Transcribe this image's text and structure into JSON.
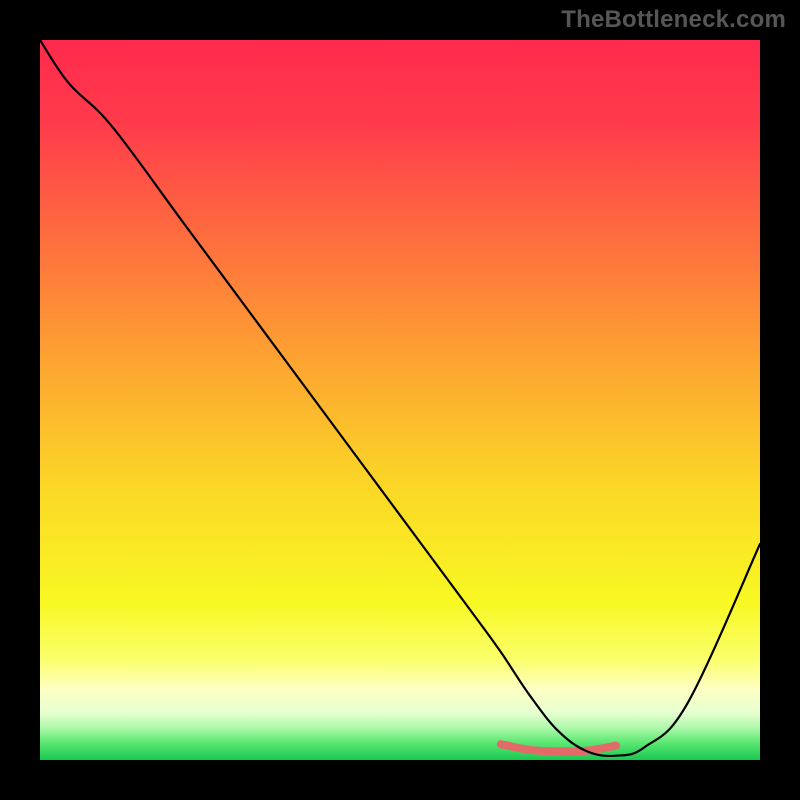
{
  "watermark": "TheBottleneck.com",
  "chart_data": {
    "type": "line",
    "title": "",
    "xlabel": "",
    "ylabel": "",
    "xlim": [
      0,
      100
    ],
    "ylim": [
      0,
      100
    ],
    "grid": false,
    "series": [
      {
        "name": "curve",
        "x": [
          0,
          4,
          10,
          20,
          30,
          40,
          50,
          60,
          64,
          68,
          72,
          76,
          80,
          84,
          90,
          100
        ],
        "y": [
          100,
          94,
          88,
          74.5,
          61,
          47.5,
          34,
          20.5,
          15,
          9,
          4,
          1.2,
          0.6,
          1.8,
          8,
          30
        ],
        "color": "#000000",
        "width": 2.2
      }
    ],
    "highlight_segment": {
      "x": [
        64,
        68,
        72,
        76,
        80
      ],
      "y": [
        2.2,
        1.4,
        1.2,
        1.3,
        2.0
      ],
      "color": "#E46A6A",
      "width": 8
    },
    "background_gradient": {
      "stops": [
        {
          "offset": 0.0,
          "color": "#FF2A4D"
        },
        {
          "offset": 0.12,
          "color": "#FF3C4B"
        },
        {
          "offset": 0.28,
          "color": "#FE6F3E"
        },
        {
          "offset": 0.45,
          "color": "#FDA531"
        },
        {
          "offset": 0.62,
          "color": "#FBD726"
        },
        {
          "offset": 0.78,
          "color": "#F8F823"
        },
        {
          "offset": 0.86,
          "color": "#FBFF6A"
        },
        {
          "offset": 0.9,
          "color": "#FEFFC2"
        },
        {
          "offset": 0.935,
          "color": "#E6FFD0"
        },
        {
          "offset": 0.955,
          "color": "#AFF9AA"
        },
        {
          "offset": 0.975,
          "color": "#5FE874"
        },
        {
          "offset": 1.0,
          "color": "#18C850"
        }
      ]
    }
  }
}
